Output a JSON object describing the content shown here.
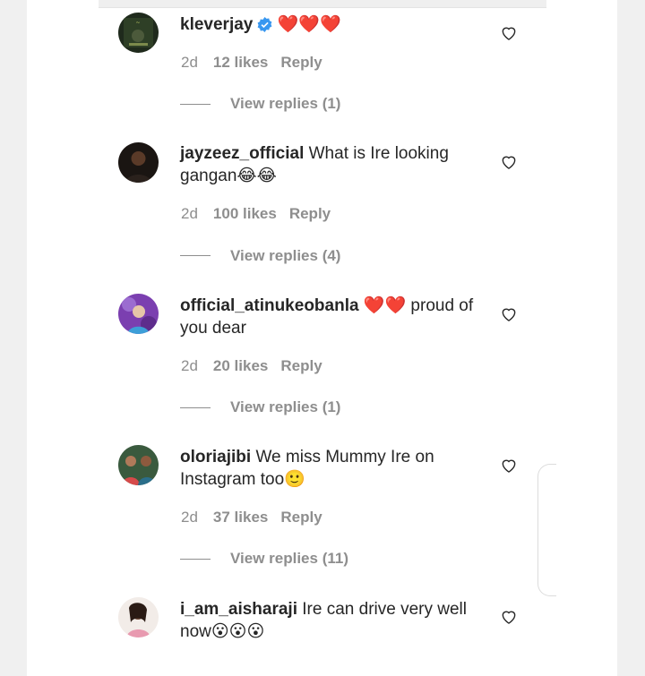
{
  "comments": [
    {
      "username": "kleverjay",
      "verified": true,
      "text": "❤️❤️❤️",
      "time": "2d",
      "likes": "12 likes",
      "reply": "Reply",
      "view_replies": "View replies (1)"
    },
    {
      "username": "jayzeez_official",
      "verified": false,
      "text": "What is Ire looking gangan😂😂",
      "time": "2d",
      "likes": "100 likes",
      "reply": "Reply",
      "view_replies": "View replies (4)"
    },
    {
      "username": "official_atinukeobanla",
      "verified": false,
      "text": "❤️❤️ proud of you dear",
      "time": "2d",
      "likes": "20 likes",
      "reply": "Reply",
      "view_replies": "View replies (1)"
    },
    {
      "username": "oloriajibi",
      "verified": false,
      "text": "We miss Mummy Ire on Instagram too🙂",
      "time": "2d",
      "likes": "37 likes",
      "reply": "Reply",
      "view_replies": "View replies (11)"
    },
    {
      "username": "i_am_aisharaji",
      "verified": false,
      "text": "Ire can drive very well now😮😮😮",
      "time": "",
      "likes": "",
      "reply": "",
      "view_replies": ""
    }
  ],
  "colors": {
    "verified_badge": "#3897f0",
    "heart_emoji": "#d11a2a",
    "meta_text": "#8e8e8e"
  },
  "icons": {
    "like": "heart-outline-icon",
    "verified": "verified-badge-icon"
  }
}
